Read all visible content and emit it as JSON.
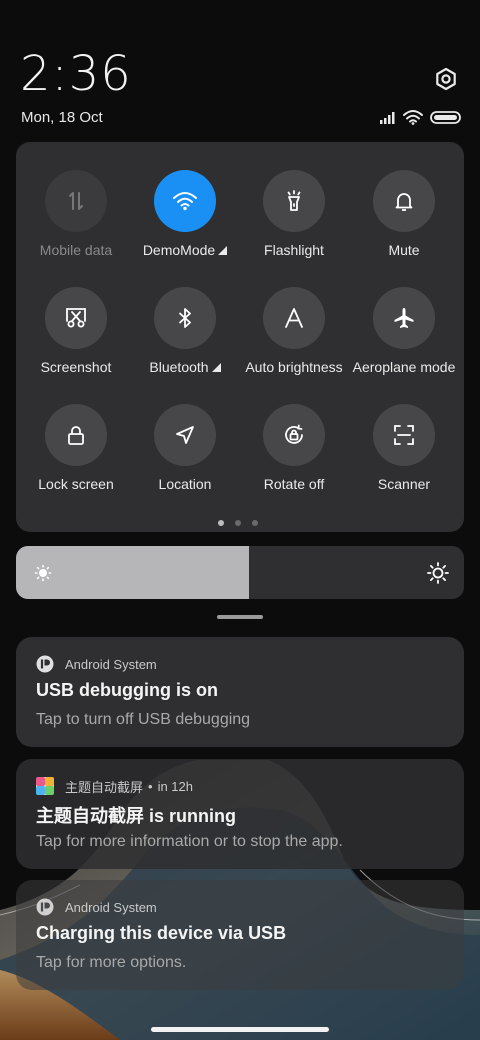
{
  "status": {
    "time": "2:36",
    "date": "Mon, 18 Oct"
  },
  "quick_settings": {
    "tiles": [
      {
        "label": "Mobile data",
        "icon": "mobile-data-icon",
        "state": "disabled"
      },
      {
        "label": "DemoMode",
        "icon": "wifi-icon",
        "state": "active",
        "expandable": true
      },
      {
        "label": "Flashlight",
        "icon": "flashlight-icon",
        "state": "off"
      },
      {
        "label": "Mute",
        "icon": "bell-icon",
        "state": "off"
      },
      {
        "label": "Screenshot",
        "icon": "screenshot-icon",
        "state": "off"
      },
      {
        "label": "Bluetooth",
        "icon": "bluetooth-icon",
        "state": "off",
        "expandable": true
      },
      {
        "label": "Auto brightness",
        "icon": "auto-brightness-icon",
        "state": "off"
      },
      {
        "label": "Aeroplane mode",
        "icon": "airplane-icon",
        "state": "off"
      },
      {
        "label": "Lock screen",
        "icon": "lock-icon",
        "state": "off"
      },
      {
        "label": "Location",
        "icon": "location-icon",
        "state": "off"
      },
      {
        "label": "Rotate off",
        "icon": "rotate-lock-icon",
        "state": "off"
      },
      {
        "label": "Scanner",
        "icon": "scanner-icon",
        "state": "off"
      }
    ],
    "page_count": 3,
    "current_page": 1
  },
  "brightness": {
    "level": 0.52
  },
  "notifications": [
    {
      "app": "Android System",
      "title": "USB debugging is on",
      "body": "Tap to turn off USB debugging"
    },
    {
      "app": "主题自动截屏",
      "time": "in 12h",
      "title": "主题自动截屏 is running",
      "body": "Tap for more information or to stop the app."
    },
    {
      "app": "Android System",
      "title": "Charging this device via USB",
      "body": "Tap for more options."
    }
  ],
  "colors": {
    "accent": "#1b90f4",
    "panel": "#2f2f31",
    "tile": "#47474a",
    "background": "#0c0c0d"
  }
}
